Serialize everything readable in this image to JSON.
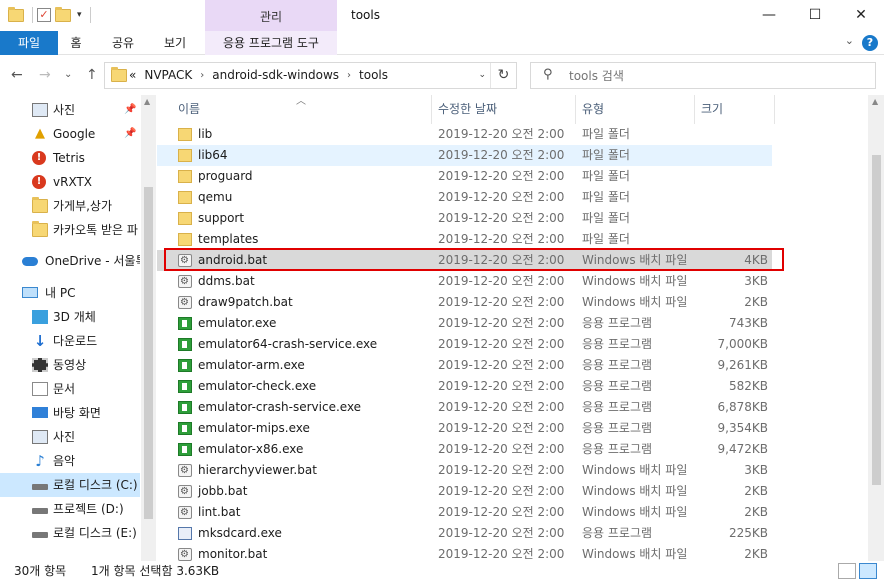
{
  "window": {
    "title": "tools",
    "context_tab_header": "관리",
    "minimize_glyph": "—",
    "maximize_glyph": "☐",
    "close_glyph": "✕"
  },
  "ribbon": {
    "tabs": [
      "파일",
      "홈",
      "공유",
      "보기",
      "응용 프로그램 도구"
    ],
    "help_glyph": "?",
    "collapse_glyph": "⌄"
  },
  "address": {
    "back_glyph": "←",
    "forward_glyph": "→",
    "recent_glyph": "⌄",
    "up_glyph": "↑",
    "overflow": "«",
    "crumbs": [
      "NVPACK",
      "android-sdk-windows",
      "tools"
    ],
    "crumb_sep": "›",
    "refresh_glyph": "↻",
    "dropdown_glyph": "⌄"
  },
  "search": {
    "placeholder": "tools 검색",
    "icon": "search-icon"
  },
  "nav": {
    "items": [
      {
        "label": "사진",
        "icon": "pictures-icon",
        "pinned": true
      },
      {
        "label": "Google",
        "icon": "google-drive-icon",
        "pinned": true
      },
      {
        "label": "Tetris",
        "icon": "red-alert-folder-icon",
        "pinned": false
      },
      {
        "label": "vRXTX",
        "icon": "red-alert-folder-icon",
        "pinned": false
      },
      {
        "label": "가게부,상가",
        "icon": "folder-icon",
        "pinned": false
      },
      {
        "label": "카카오톡 받은 파",
        "icon": "folder-icon",
        "pinned": false
      },
      {
        "label": "OneDrive - 서울특",
        "icon": "onedrive-icon",
        "pinned": false
      },
      {
        "label": "내 PC",
        "icon": "pc-icon",
        "pinned": false
      },
      {
        "label": "3D 개체",
        "icon": "3d-objects-icon",
        "pinned": false
      },
      {
        "label": "다운로드",
        "icon": "downloads-icon",
        "pinned": false
      },
      {
        "label": "동영상",
        "icon": "videos-icon",
        "pinned": false
      },
      {
        "label": "문서",
        "icon": "documents-icon",
        "pinned": false
      },
      {
        "label": "바탕 화면",
        "icon": "desktop-icon",
        "pinned": false
      },
      {
        "label": "사진",
        "icon": "pictures-icon",
        "pinned": false
      },
      {
        "label": "음악",
        "icon": "music-icon",
        "pinned": false
      },
      {
        "label": "로컬 디스크 (C:)",
        "icon": "drive-icon",
        "pinned": false,
        "selected": true
      },
      {
        "label": "프로젝트 (D:)",
        "icon": "drive-icon",
        "pinned": false
      },
      {
        "label": "로컬 디스크 (E:)",
        "icon": "drive-icon",
        "pinned": false
      }
    ],
    "pin_glyph": "📌"
  },
  "columns": [
    "이름",
    "수정한 날짜",
    "유형",
    "크기"
  ],
  "files": [
    {
      "name": "lib",
      "date": "2019-12-20 오전 2:00",
      "type": "파일 폴더",
      "size": "",
      "icon": "folder-icon"
    },
    {
      "name": "lib64",
      "date": "2019-12-20 오전 2:00",
      "type": "파일 폴더",
      "size": "",
      "icon": "folder-icon"
    },
    {
      "name": "proguard",
      "date": "2019-12-20 오전 2:00",
      "type": "파일 폴더",
      "size": "",
      "icon": "folder-icon"
    },
    {
      "name": "qemu",
      "date": "2019-12-20 오전 2:00",
      "type": "파일 폴더",
      "size": "",
      "icon": "folder-icon"
    },
    {
      "name": "support",
      "date": "2019-12-20 오전 2:00",
      "type": "파일 폴더",
      "size": "",
      "icon": "folder-icon"
    },
    {
      "name": "templates",
      "date": "2019-12-20 오전 2:00",
      "type": "파일 폴더",
      "size": "",
      "icon": "folder-icon"
    },
    {
      "name": "android.bat",
      "date": "2019-12-20 오전 2:00",
      "type": "Windows 배치 파일",
      "size": "4KB",
      "icon": "batch-file-icon"
    },
    {
      "name": "ddms.bat",
      "date": "2019-12-20 오전 2:00",
      "type": "Windows 배치 파일",
      "size": "3KB",
      "icon": "batch-file-icon"
    },
    {
      "name": "draw9patch.bat",
      "date": "2019-12-20 오전 2:00",
      "type": "Windows 배치 파일",
      "size": "2KB",
      "icon": "batch-file-icon"
    },
    {
      "name": "emulator.exe",
      "date": "2019-12-20 오전 2:00",
      "type": "응용 프로그램",
      "size": "743KB",
      "icon": "exe-icon"
    },
    {
      "name": "emulator64-crash-service.exe",
      "date": "2019-12-20 오전 2:00",
      "type": "응용 프로그램",
      "size": "7,000KB",
      "icon": "exe-icon"
    },
    {
      "name": "emulator-arm.exe",
      "date": "2019-12-20 오전 2:00",
      "type": "응용 프로그램",
      "size": "9,261KB",
      "icon": "exe-icon"
    },
    {
      "name": "emulator-check.exe",
      "date": "2019-12-20 오전 2:00",
      "type": "응용 프로그램",
      "size": "582KB",
      "icon": "exe-icon"
    },
    {
      "name": "emulator-crash-service.exe",
      "date": "2019-12-20 오전 2:00",
      "type": "응용 프로그램",
      "size": "6,878KB",
      "icon": "exe-icon"
    },
    {
      "name": "emulator-mips.exe",
      "date": "2019-12-20 오전 2:00",
      "type": "응용 프로그램",
      "size": "9,354KB",
      "icon": "exe-icon"
    },
    {
      "name": "emulator-x86.exe",
      "date": "2019-12-20 오전 2:00",
      "type": "응용 프로그램",
      "size": "9,472KB",
      "icon": "exe-icon"
    },
    {
      "name": "hierarchyviewer.bat",
      "date": "2019-12-20 오전 2:00",
      "type": "Windows 배치 파일",
      "size": "3KB",
      "icon": "batch-file-icon"
    },
    {
      "name": "jobb.bat",
      "date": "2019-12-20 오전 2:00",
      "type": "Windows 배치 파일",
      "size": "2KB",
      "icon": "batch-file-icon"
    },
    {
      "name": "lint.bat",
      "date": "2019-12-20 오전 2:00",
      "type": "Windows 배치 파일",
      "size": "2KB",
      "icon": "batch-file-icon"
    },
    {
      "name": "mksdcard.exe",
      "date": "2019-12-20 오전 2:00",
      "type": "응용 프로그램",
      "size": "225KB",
      "icon": "mksdcard-app-icon"
    },
    {
      "name": "monitor.bat",
      "date": "2019-12-20 오전 2:00",
      "type": "Windows 배치 파일",
      "size": "2KB",
      "icon": "batch-file-icon"
    }
  ],
  "hovered_row": 1,
  "selected_row": 6,
  "status": {
    "count": "30개 항목",
    "selection": "1개 항목 선택함 3.63KB"
  },
  "colors": {
    "accent": "#1979ca",
    "context_tab": "#e9d9f6",
    "selected_row": "#d9d9d9",
    "hover_row": "#e5f3ff",
    "highlight_box": "#e00000"
  }
}
